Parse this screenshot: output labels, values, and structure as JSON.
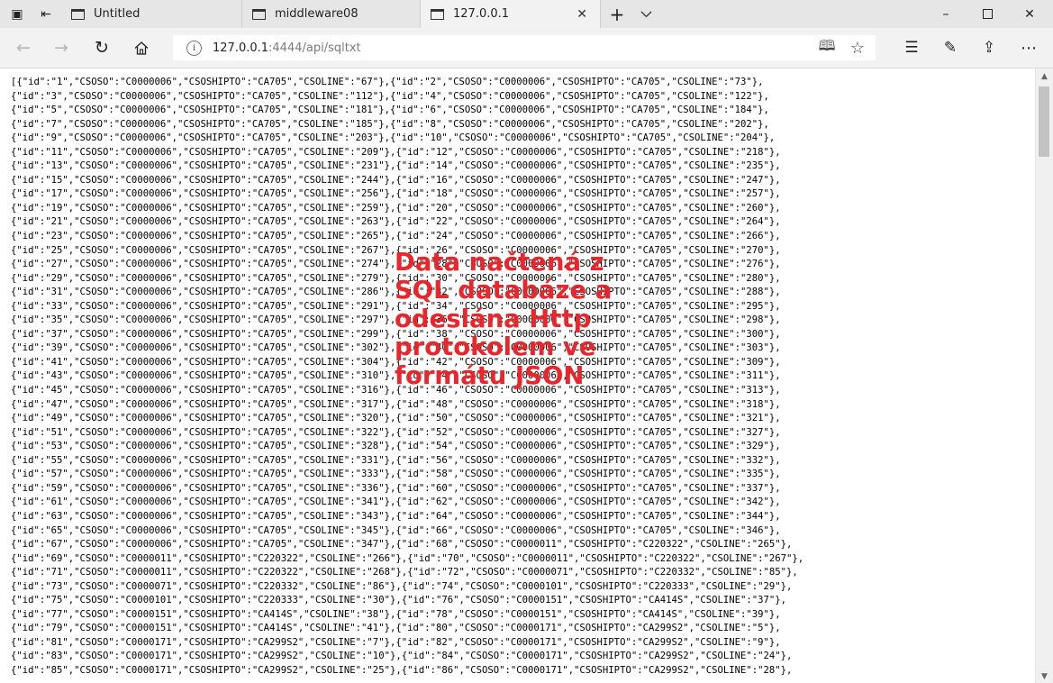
{
  "tabs": [
    {
      "title": "Untitled",
      "icon": "page-icon"
    },
    {
      "title": "middleware08",
      "icon": "page-icon"
    },
    {
      "title": "127.0.0.1",
      "icon": "page-icon",
      "active": true
    }
  ],
  "address": {
    "host": "127.0.0.1",
    "rest": ":4444/api/sqltxt"
  },
  "icons": {
    "tab_actions": "tab-actions-icon",
    "set_aside": "set-aside-tabs-icon",
    "new_tab": "+",
    "tab_list": "chevron-down-icon",
    "back": "back-arrow-icon",
    "forward": "forward-arrow-icon",
    "refresh": "refresh-icon",
    "home": "home-icon",
    "info": "info-icon",
    "reading_view": "reading-view-icon",
    "favorite": "star-icon",
    "favorites_hub": "favorites-hub-icon",
    "notes": "pen-icon",
    "share": "share-icon",
    "more": "more-icon"
  },
  "content": {
    "json_lines": [
      "[{\"id\":\"1\",\"CSOSO\":\"C0000006\",\"CSOSHIPTO\":\"CA705\",\"CSOLINE\":\"67\"},{\"id\":\"2\",\"CSOSO\":\"C0000006\",\"CSOSHIPTO\":\"CA705\",\"CSOLINE\":\"73\"},",
      "{\"id\":\"3\",\"CSOSO\":\"C0000006\",\"CSOSHIPTO\":\"CA705\",\"CSOLINE\":\"112\"},{\"id\":\"4\",\"CSOSO\":\"C0000006\",\"CSOSHIPTO\":\"CA705\",\"CSOLINE\":\"122\"},",
      "{\"id\":\"5\",\"CSOSO\":\"C0000006\",\"CSOSHIPTO\":\"CA705\",\"CSOLINE\":\"181\"},{\"id\":\"6\",\"CSOSO\":\"C0000006\",\"CSOSHIPTO\":\"CA705\",\"CSOLINE\":\"184\"},",
      "{\"id\":\"7\",\"CSOSO\":\"C0000006\",\"CSOSHIPTO\":\"CA705\",\"CSOLINE\":\"185\"},{\"id\":\"8\",\"CSOSO\":\"C0000006\",\"CSOSHIPTO\":\"CA705\",\"CSOLINE\":\"202\"},",
      "{\"id\":\"9\",\"CSOSO\":\"C0000006\",\"CSOSHIPTO\":\"CA705\",\"CSOLINE\":\"203\"},{\"id\":\"10\",\"CSOSO\":\"C0000006\",\"CSOSHIPTO\":\"CA705\",\"CSOLINE\":\"204\"},",
      "{\"id\":\"11\",\"CSOSO\":\"C0000006\",\"CSOSHIPTO\":\"CA705\",\"CSOLINE\":\"209\"},{\"id\":\"12\",\"CSOSO\":\"C0000006\",\"CSOSHIPTO\":\"CA705\",\"CSOLINE\":\"218\"},",
      "{\"id\":\"13\",\"CSOSO\":\"C0000006\",\"CSOSHIPTO\":\"CA705\",\"CSOLINE\":\"231\"},{\"id\":\"14\",\"CSOSO\":\"C0000006\",\"CSOSHIPTO\":\"CA705\",\"CSOLINE\":\"235\"},",
      "{\"id\":\"15\",\"CSOSO\":\"C0000006\",\"CSOSHIPTO\":\"CA705\",\"CSOLINE\":\"244\"},{\"id\":\"16\",\"CSOSO\":\"C0000006\",\"CSOSHIPTO\":\"CA705\",\"CSOLINE\":\"247\"},",
      "{\"id\":\"17\",\"CSOSO\":\"C0000006\",\"CSOSHIPTO\":\"CA705\",\"CSOLINE\":\"256\"},{\"id\":\"18\",\"CSOSO\":\"C0000006\",\"CSOSHIPTO\":\"CA705\",\"CSOLINE\":\"257\"},",
      "{\"id\":\"19\",\"CSOSO\":\"C0000006\",\"CSOSHIPTO\":\"CA705\",\"CSOLINE\":\"259\"},{\"id\":\"20\",\"CSOSO\":\"C0000006\",\"CSOSHIPTO\":\"CA705\",\"CSOLINE\":\"260\"},",
      "{\"id\":\"21\",\"CSOSO\":\"C0000006\",\"CSOSHIPTO\":\"CA705\",\"CSOLINE\":\"263\"},{\"id\":\"22\",\"CSOSO\":\"C0000006\",\"CSOSHIPTO\":\"CA705\",\"CSOLINE\":\"264\"},",
      "{\"id\":\"23\",\"CSOSO\":\"C0000006\",\"CSOSHIPTO\":\"CA705\",\"CSOLINE\":\"265\"},{\"id\":\"24\",\"CSOSO\":\"C0000006\",\"CSOSHIPTO\":\"CA705\",\"CSOLINE\":\"266\"},",
      "{\"id\":\"25\",\"CSOSO\":\"C0000006\",\"CSOSHIPTO\":\"CA705\",\"CSOLINE\":\"267\"},{\"id\":\"26\",\"CSOSO\":\"C0000006\",\"CSOSHIPTO\":\"CA705\",\"CSOLINE\":\"270\"},",
      "{\"id\":\"27\",\"CSOSO\":\"C0000006\",\"CSOSHIPTO\":\"CA705\",\"CSOLINE\":\"274\"},{\"id\":\"28\",\"CSOSO\":\"C0000006\",\"CSOSHIPTO\":\"CA705\",\"CSOLINE\":\"276\"},",
      "{\"id\":\"29\",\"CSOSO\":\"C0000006\",\"CSOSHIPTO\":\"CA705\",\"CSOLINE\":\"279\"},{\"id\":\"30\",\"CSOSO\":\"C0000006\",\"CSOSHIPTO\":\"CA705\",\"CSOLINE\":\"280\"},",
      "{\"id\":\"31\",\"CSOSO\":\"C0000006\",\"CSOSHIPTO\":\"CA705\",\"CSOLINE\":\"286\"},{\"id\":\"32\",\"CSOSO\":\"C0000006\",\"CSOSHIPTO\":\"CA705\",\"CSOLINE\":\"288\"},",
      "{\"id\":\"33\",\"CSOSO\":\"C0000006\",\"CSOSHIPTO\":\"CA705\",\"CSOLINE\":\"291\"},{\"id\":\"34\",\"CSOSO\":\"C0000006\",\"CSOSHIPTO\":\"CA705\",\"CSOLINE\":\"295\"},",
      "{\"id\":\"35\",\"CSOSO\":\"C0000006\",\"CSOSHIPTO\":\"CA705\",\"CSOLINE\":\"297\"},{\"id\":\"36\",\"CSOSO\":\"C0000006\",\"CSOSHIPTO\":\"CA705\",\"CSOLINE\":\"298\"},",
      "{\"id\":\"37\",\"CSOSO\":\"C0000006\",\"CSOSHIPTO\":\"CA705\",\"CSOLINE\":\"299\"},{\"id\":\"38\",\"CSOSO\":\"C0000006\",\"CSOSHIPTO\":\"CA705\",\"CSOLINE\":\"300\"},",
      "{\"id\":\"39\",\"CSOSO\":\"C0000006\",\"CSOSHIPTO\":\"CA705\",\"CSOLINE\":\"302\"},{\"id\":\"40\",\"CSOSO\":\"C0000006\",\"CSOSHIPTO\":\"CA705\",\"CSOLINE\":\"303\"},",
      "{\"id\":\"41\",\"CSOSO\":\"C0000006\",\"CSOSHIPTO\":\"CA705\",\"CSOLINE\":\"304\"},{\"id\":\"42\",\"CSOSO\":\"C0000006\",\"CSOSHIPTO\":\"CA705\",\"CSOLINE\":\"309\"},",
      "{\"id\":\"43\",\"CSOSO\":\"C0000006\",\"CSOSHIPTO\":\"CA705\",\"CSOLINE\":\"310\"},{\"id\":\"44\",\"CSOSO\":\"C0000006\",\"CSOSHIPTO\":\"CA705\",\"CSOLINE\":\"311\"},",
      "{\"id\":\"45\",\"CSOSO\":\"C0000006\",\"CSOSHIPTO\":\"CA705\",\"CSOLINE\":\"316\"},{\"id\":\"46\",\"CSOSO\":\"C0000006\",\"CSOSHIPTO\":\"CA705\",\"CSOLINE\":\"313\"},",
      "{\"id\":\"47\",\"CSOSO\":\"C0000006\",\"CSOSHIPTO\":\"CA705\",\"CSOLINE\":\"317\"},{\"id\":\"48\",\"CSOSO\":\"C0000006\",\"CSOSHIPTO\":\"CA705\",\"CSOLINE\":\"318\"},",
      "{\"id\":\"49\",\"CSOSO\":\"C0000006\",\"CSOSHIPTO\":\"CA705\",\"CSOLINE\":\"320\"},{\"id\":\"50\",\"CSOSO\":\"C0000006\",\"CSOSHIPTO\":\"CA705\",\"CSOLINE\":\"321\"},",
      "{\"id\":\"51\",\"CSOSO\":\"C0000006\",\"CSOSHIPTO\":\"CA705\",\"CSOLINE\":\"322\"},{\"id\":\"52\",\"CSOSO\":\"C0000006\",\"CSOSHIPTO\":\"CA705\",\"CSOLINE\":\"327\"},",
      "{\"id\":\"53\",\"CSOSO\":\"C0000006\",\"CSOSHIPTO\":\"CA705\",\"CSOLINE\":\"328\"},{\"id\":\"54\",\"CSOSO\":\"C0000006\",\"CSOSHIPTO\":\"CA705\",\"CSOLINE\":\"329\"},",
      "{\"id\":\"55\",\"CSOSO\":\"C0000006\",\"CSOSHIPTO\":\"CA705\",\"CSOLINE\":\"331\"},{\"id\":\"56\",\"CSOSO\":\"C0000006\",\"CSOSHIPTO\":\"CA705\",\"CSOLINE\":\"332\"},",
      "{\"id\":\"57\",\"CSOSO\":\"C0000006\",\"CSOSHIPTO\":\"CA705\",\"CSOLINE\":\"333\"},{\"id\":\"58\",\"CSOSO\":\"C0000006\",\"CSOSHIPTO\":\"CA705\",\"CSOLINE\":\"335\"},",
      "{\"id\":\"59\",\"CSOSO\":\"C0000006\",\"CSOSHIPTO\":\"CA705\",\"CSOLINE\":\"336\"},{\"id\":\"60\",\"CSOSO\":\"C0000006\",\"CSOSHIPTO\":\"CA705\",\"CSOLINE\":\"337\"},",
      "{\"id\":\"61\",\"CSOSO\":\"C0000006\",\"CSOSHIPTO\":\"CA705\",\"CSOLINE\":\"341\"},{\"id\":\"62\",\"CSOSO\":\"C0000006\",\"CSOSHIPTO\":\"CA705\",\"CSOLINE\":\"342\"},",
      "{\"id\":\"63\",\"CSOSO\":\"C0000006\",\"CSOSHIPTO\":\"CA705\",\"CSOLINE\":\"343\"},{\"id\":\"64\",\"CSOSO\":\"C0000006\",\"CSOSHIPTO\":\"CA705\",\"CSOLINE\":\"344\"},",
      "{\"id\":\"65\",\"CSOSO\":\"C0000006\",\"CSOSHIPTO\":\"CA705\",\"CSOLINE\":\"345\"},{\"id\":\"66\",\"CSOSO\":\"C0000006\",\"CSOSHIPTO\":\"CA705\",\"CSOLINE\":\"346\"},",
      "{\"id\":\"67\",\"CSOSO\":\"C0000006\",\"CSOSHIPTO\":\"CA705\",\"CSOLINE\":\"347\"},{\"id\":\"68\",\"CSOSO\":\"C0000011\",\"CSOSHIPTO\":\"C220322\",\"CSOLINE\":\"265\"},",
      "{\"id\":\"69\",\"CSOSO\":\"C0000011\",\"CSOSHIPTO\":\"C220322\",\"CSOLINE\":\"266\"},{\"id\":\"70\",\"CSOSO\":\"C0000011\",\"CSOSHIPTO\":\"C220322\",\"CSOLINE\":\"267\"},",
      "{\"id\":\"71\",\"CSOSO\":\"C0000011\",\"CSOSHIPTO\":\"C220322\",\"CSOLINE\":\"268\"},{\"id\":\"72\",\"CSOSO\":\"C0000071\",\"CSOSHIPTO\":\"C220332\",\"CSOLINE\":\"85\"},",
      "{\"id\":\"73\",\"CSOSO\":\"C0000071\",\"CSOSHIPTO\":\"C220332\",\"CSOLINE\":\"86\"},{\"id\":\"74\",\"CSOSO\":\"C0000101\",\"CSOSHIPTO\":\"C220333\",\"CSOLINE\":\"29\"},",
      "{\"id\":\"75\",\"CSOSO\":\"C0000101\",\"CSOSHIPTO\":\"C220333\",\"CSOLINE\":\"30\"},{\"id\":\"76\",\"CSOSO\":\"C0000151\",\"CSOSHIPTO\":\"CA414S\",\"CSOLINE\":\"37\"},",
      "{\"id\":\"77\",\"CSOSO\":\"C0000151\",\"CSOSHIPTO\":\"CA414S\",\"CSOLINE\":\"38\"},{\"id\":\"78\",\"CSOSO\":\"C0000151\",\"CSOSHIPTO\":\"CA414S\",\"CSOLINE\":\"39\"},",
      "{\"id\":\"79\",\"CSOSO\":\"C0000151\",\"CSOSHIPTO\":\"CA414S\",\"CSOLINE\":\"41\"},{\"id\":\"80\",\"CSOSO\":\"C0000171\",\"CSOSHIPTO\":\"CA299S2\",\"CSOLINE\":\"5\"},",
      "{\"id\":\"81\",\"CSOSO\":\"C0000171\",\"CSOSHIPTO\":\"CA299S2\",\"CSOLINE\":\"7\"},{\"id\":\"82\",\"CSOSO\":\"C0000171\",\"CSOSHIPTO\":\"CA299S2\",\"CSOLINE\":\"9\"},",
      "{\"id\":\"83\",\"CSOSO\":\"C0000171\",\"CSOSHIPTO\":\"CA299S2\",\"CSOLINE\":\"10\"},{\"id\":\"84\",\"CSOSO\":\"C0000171\",\"CSOSHIPTO\":\"CA299S2\",\"CSOLINE\":\"24\"},",
      "{\"id\":\"85\",\"CSOSO\":\"C0000171\",\"CSOSHIPTO\":\"CA299S2\",\"CSOLINE\":\"25\"},{\"id\":\"86\",\"CSOSO\":\"C0000171\",\"CSOSHIPTO\":\"CA299S2\",\"CSOLINE\":\"28\"},"
    ]
  },
  "overlay": {
    "lines": [
      "Data načtená z",
      "SQL databáze a",
      "odeslána Http",
      "protokolem ve",
      "formátu JSON"
    ],
    "color": "#e8262c"
  },
  "colors": {
    "tabbar_bg": "#e6e6e6",
    "toolbar_bg": "#f2f2f2",
    "page_bg": "#ffffff"
  }
}
